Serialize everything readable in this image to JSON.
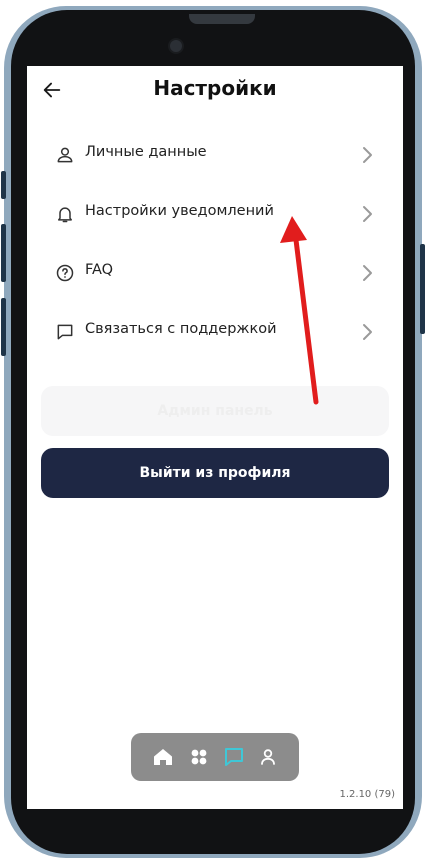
{
  "header": {
    "title": "Настройки"
  },
  "menu": [
    {
      "label": "Личные данные",
      "icon": "person-icon"
    },
    {
      "label": "Настройки уведомлений",
      "icon": "bell-icon"
    },
    {
      "label": "FAQ",
      "icon": "help-circle-icon"
    },
    {
      "label": "Связаться с поддержкой",
      "icon": "chat-icon"
    }
  ],
  "buttons": {
    "admin": "Админ панель",
    "logout": "Выйти из профиля"
  },
  "tabbar": {
    "active_color": "#3fc7d6",
    "items": [
      "home-icon",
      "grid-icon",
      "chat-icon",
      "profile-icon"
    ]
  },
  "version": "1.2.10 (79)",
  "colors": {
    "logout_button": "#1e2744",
    "annotation_arrow": "#e11d1d",
    "frame": "#8fa8bd"
  }
}
